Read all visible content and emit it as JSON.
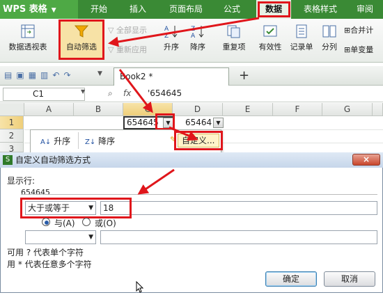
{
  "app": {
    "name": "WPS 表格"
  },
  "menu": [
    "开始",
    "插入",
    "页面布局",
    "公式",
    "数据",
    "表格样式",
    "审阅"
  ],
  "ribbon": {
    "pivot": "数据透视表",
    "autofilter": "自动筛选",
    "show_all": "全部显示",
    "reapply": "重新应用",
    "sort_asc": "升序",
    "sort_desc": "降序",
    "duplicates": "重复项",
    "validity": "有效性",
    "record": "记录单",
    "split": "分列",
    "merge_calc": "合并计",
    "single_var": "单变量"
  },
  "doc": {
    "tab": "Book2 *",
    "add": "+"
  },
  "formula_bar": {
    "cell": "C1",
    "fx": "fx",
    "value": "'654645"
  },
  "grid": {
    "columns": [
      "A",
      "B",
      "C",
      "D",
      "E",
      "F",
      "G"
    ],
    "rows": [
      "1",
      "2",
      "3"
    ],
    "c1": "654645",
    "d1": "65464"
  },
  "filter_menu": {
    "asc": "升序",
    "desc": "降序",
    "custom": "自定义..."
  },
  "dialog": {
    "title": "自定义自动筛选方式",
    "close": "×",
    "show_rows": "显示行:",
    "field": "654645",
    "op1": "大于或等于",
    "val1": "18",
    "and": "与(A)",
    "or": "或(O)",
    "hint1": "可用 ? 代表单个字符",
    "hint2": "用 * 代表任意多个字符",
    "ok": "确定",
    "cancel": "取消"
  },
  "colors": {
    "menubar": "#3a8a35",
    "highlight": "#e0161b",
    "dialog_title": "#c6d6ea"
  }
}
